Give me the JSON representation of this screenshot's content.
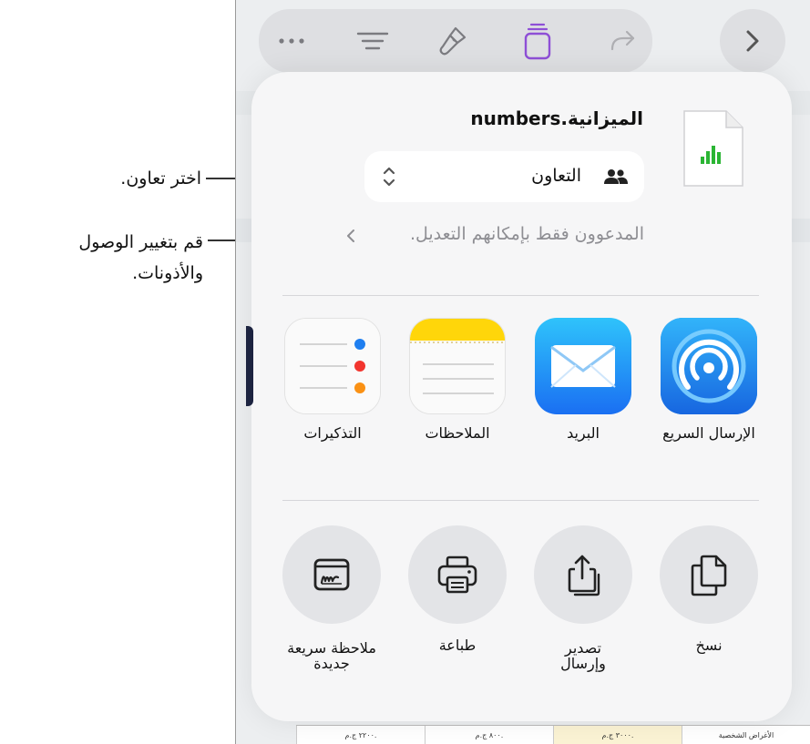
{
  "toolbar": {
    "icons": [
      "more-icon",
      "format-icon",
      "paintbrush-icon",
      "share-icon",
      "redo-icon",
      "chevron-right-icon"
    ]
  },
  "document": {
    "name": "الميزانية.numbers"
  },
  "collaboration": {
    "mode_label": "التعاون",
    "access_text": "المدعوون فقط بإمكانهم التعديل."
  },
  "apps": [
    {
      "label": "الإرسال السريع",
      "icon": "airdrop-icon"
    },
    {
      "label": "البريد",
      "icon": "mail-icon"
    },
    {
      "label": "الملاحظات",
      "icon": "notes-icon"
    },
    {
      "label": "التذكيرات",
      "icon": "reminders-icon"
    }
  ],
  "actions": [
    {
      "label": "نسخ",
      "icon": "copy-icon"
    },
    {
      "label_line1": "تصدير",
      "label_line2": "وإرسال",
      "icon": "export-icon"
    },
    {
      "label": "طباعة",
      "icon": "print-icon"
    },
    {
      "label_line1": "ملاحظة سريعة",
      "label_line2": "جديدة",
      "icon": "quick-note-icon"
    }
  ],
  "annotations": {
    "choose_collaborate": "اختر تعاون.",
    "change_access_line1": "قم بتغيير الوصول",
    "change_access_line2": "والأذونات."
  },
  "background_table": {
    "cells": [
      "الأغراض الشخصية",
      "٣٠٠٠ ج.م.",
      "٨٠٠ ج.م.",
      "٢٢٠٠ ج.م."
    ]
  },
  "colors": {
    "accent_purple": "#8e4fd6",
    "airdrop_blue": "#1f8ff0",
    "mail_blue": "#2b8df6",
    "notes_yellow": "#ffd60a",
    "sheet_bg": "#f6f6f7"
  }
}
